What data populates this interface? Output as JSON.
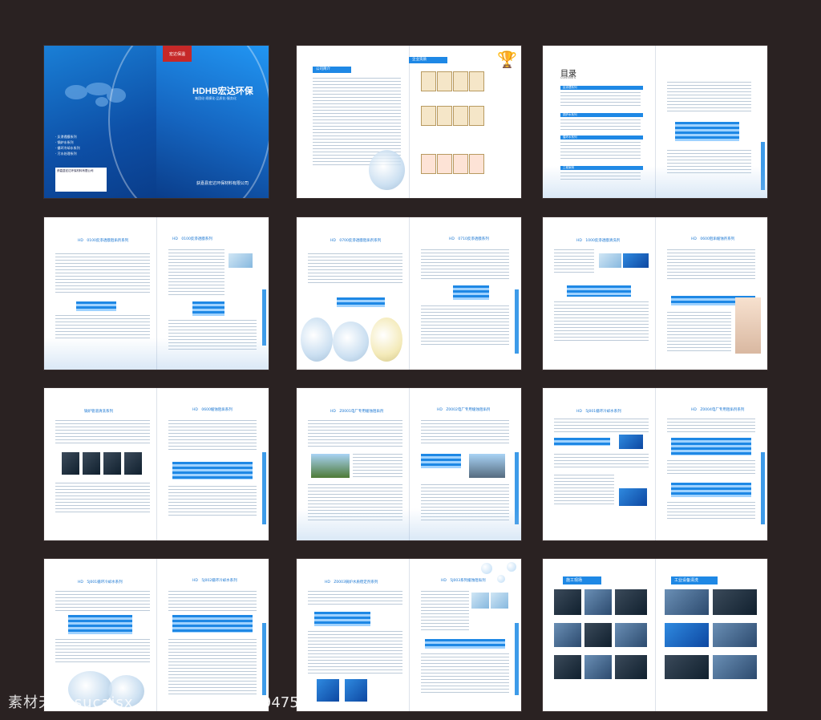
{
  "cover": {
    "logo": "宏达保温",
    "title": "HDHB宏达环保",
    "subtitle": "集团化·规模化·品质化·服务化",
    "list": [
      "· 反渗透膜系列",
      "· 锅炉水系列",
      "· 循环冷却水系列",
      "· 污水处理系列"
    ],
    "info_title": "获嘉县宏达环保材料有限公司",
    "company": "获嘉县宏达环保材料有限公司"
  },
  "intro": {
    "header": "公司简介",
    "cert_header": "企业资质"
  },
  "toc": {
    "title": "目录",
    "subtitle": "CONTENTS",
    "sections": [
      "反渗透系列",
      "锅炉水系列",
      "循环水系列",
      "工程案例"
    ]
  },
  "pages": {
    "p4_left": "HD　0100反渗透膜阻垢剂系列",
    "p4_right": "HD　0100反渗透膜系列",
    "p5_left": "HD　0700反渗透膜阻垢剂系列",
    "p5_right": "HD　0710反渗透膜系列",
    "p6_left": "HD　1000反渗透膜清洗剂",
    "p6_right": "HD　0600阻垢缓蚀剂系列",
    "p7_left": "锅炉管道清洗系列",
    "p7_right": "HD　0600缓蚀阻垢系列",
    "p8_left": "HD　Z0001电厂专用缓蚀阻垢剂",
    "p8_right": "HD　Z0002电厂专用缓蚀阻垢剂",
    "p9_left": "HD　5J001循环冷却水系列",
    "p9_right": "HD　Z0004电厂专用阻垢剂系列",
    "p10_left": "HD　5J001循环冷却水系列",
    "p10_right": "HD　5J002循环冷却水系列",
    "p11_left": "HD　Z0003锅炉水质稳定剂系列",
    "p11_right": "HD　5J003系列缓蚀阻垢剂",
    "site_header": "施工现场",
    "equipment_header": "工业设备清洗"
  },
  "watermark": {
    "site": "素材天下 sucaisx.com",
    "id": "编号：03947599"
  }
}
